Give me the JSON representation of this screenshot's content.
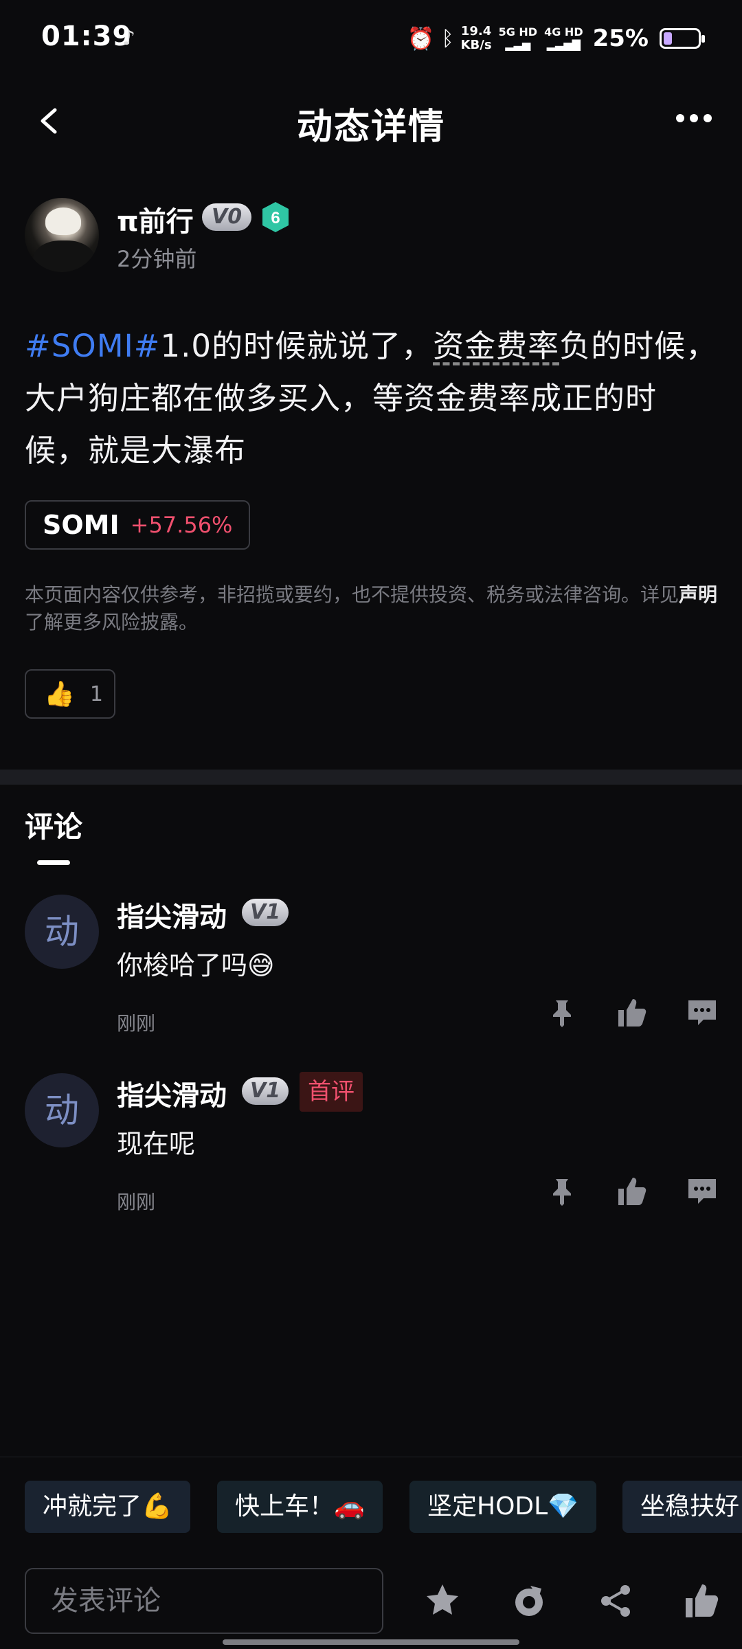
{
  "status_bar": {
    "time": "01:39",
    "speed_top": "19.4",
    "speed_bottom": "KB/s",
    "net1": "5G HD",
    "net2": "4G HD",
    "battery": "25%"
  },
  "header": {
    "title": "动态详情"
  },
  "post": {
    "author": "π前行",
    "badge": "V0",
    "level": "6",
    "time": "2分钟前",
    "text_tag": "#SOMI#",
    "text_1": "1.0的时候就说了，",
    "text_underlined": "资金费率",
    "text_2": "负的时候，大户狗庄都在做多买入，等资金费率成正的时候，就是大瀑布",
    "coin_name": "SOMI",
    "coin_change": "+57.56%",
    "disclaimer_1": "本页面内容仅供参考，非招揽或要约，也不提供投资、税务或法律咨询。详见",
    "disclaimer_link": "声明",
    "disclaimer_2": "了解更多风险披露。",
    "like_emoji": "👍",
    "like_count": "1"
  },
  "comments_section": {
    "title": "评论",
    "items": [
      {
        "avatar": "动",
        "name": "指尖滑动",
        "badge": "V1",
        "text": "你梭哈了吗😅",
        "time": "刚刚",
        "first_label": ""
      },
      {
        "avatar": "动",
        "name": "指尖滑动",
        "badge": "V1",
        "text": "现在呢",
        "time": "刚刚",
        "first_label": "首评"
      }
    ]
  },
  "quick_replies": [
    "冲就完了💪",
    "快上车！🚗",
    "坚定HODL💎",
    "坐稳扶好"
  ],
  "input": {
    "placeholder": "发表评论"
  },
  "icons": [
    "back-icon",
    "more-icon",
    "pin-icon",
    "thumb-up-icon",
    "comment-icon",
    "star-icon",
    "repost-icon",
    "share-icon"
  ],
  "colors": {
    "background": "#0b0b0d",
    "hashtag": "#3f7cf2",
    "positive_change": "#f0506e",
    "level_badge": "#2fc6a4"
  }
}
